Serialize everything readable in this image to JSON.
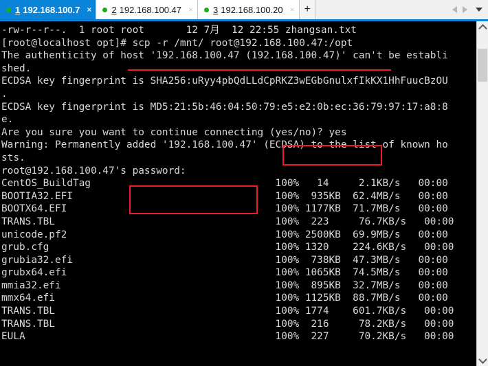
{
  "window": {
    "tab_nav": {
      "prev_icon": "chevron-left-icon",
      "next_icon": "chevron-right-icon",
      "menu_icon": "chevron-down-icon"
    },
    "new_tab_label": "+"
  },
  "tabs": [
    {
      "number": "1",
      "label": "192.168.100.7",
      "close_label": "×",
      "status": "connected",
      "active": true
    },
    {
      "number": "2",
      "label": "192.168.100.47",
      "close_label": "×",
      "status": "connected",
      "active": false
    },
    {
      "number": "3",
      "label": "192.168.100.20",
      "close_label": "×",
      "status": "connected",
      "active": false
    }
  ],
  "terminal": {
    "lines": [
      "-rw-r--r--.  1 root root       12 7月  12 22:55 zhangsan.txt",
      "[root@localhost opt]# scp -r /mnt/ root@192.168.100.47:/opt",
      "The authenticity of host '192.168.100.47 (192.168.100.47)' can't be establi",
      "shed.",
      "ECDSA key fingerprint is SHA256:uRyy4pbQdLLdCpRKZ3wEGbGnulxfIkKX1HhFuucBzOU",
      ".",
      "ECDSA key fingerprint is MD5:21:5b:46:04:50:79:e5:e2:0b:ec:36:79:97:17:a8:8",
      "e.",
      "Are you sure you want to continue connecting (yes/no)? yes",
      "Warning: Permanently added '192.168.100.47' (ECDSA) to the list of known ho",
      "sts.",
      "root@192.168.100.47's password:",
      "CentOS_BuildTag                               100%   14     2.1KB/s   00:00",
      "BOOTIA32.EFI                                  100%  935KB  62.4MB/s   00:00",
      "BOOTX64.EFI                                   100% 1177KB  71.7MB/s   00:00",
      "TRANS.TBL                                     100%  223     76.7KB/s   00:00",
      "unicode.pf2                                   100% 2500KB  69.9MB/s   00:00",
      "grub.cfg                                      100% 1320    224.6KB/s   00:00",
      "grubia32.efi                                  100%  738KB  47.3MB/s   00:00",
      "grubx64.efi                                   100% 1065KB  74.5MB/s   00:00",
      "mmia32.efi                                    100%  895KB  32.7MB/s   00:00",
      "mmx64.efi                                     100% 1125KB  88.7MB/s   00:00",
      "TRANS.TBL                                     100% 1774    601.7KB/s   00:00",
      "TRANS.TBL                                     100%  216     78.2KB/s   00:00",
      "EULA                                          100%  227     70.2KB/s   00:00"
    ],
    "command": "scp -r /mnt/ root@192.168.100.47:/opt",
    "prompt": "[root@localhost opt]#",
    "confirm_answer": "yes",
    "password_prompt": "password:",
    "transfers": [
      {
        "file": "CentOS_BuildTag",
        "percent": "100%",
        "size": "14",
        "speed": "2.1KB/s",
        "eta": "00:00"
      },
      {
        "file": "BOOTIA32.EFI",
        "percent": "100%",
        "size": "935KB",
        "speed": "62.4MB/s",
        "eta": "00:00"
      },
      {
        "file": "BOOTX64.EFI",
        "percent": "100%",
        "size": "1177KB",
        "speed": "71.7MB/s",
        "eta": "00:00"
      },
      {
        "file": "TRANS.TBL",
        "percent": "100%",
        "size": "223",
        "speed": "76.7KB/s",
        "eta": "00:00"
      },
      {
        "file": "unicode.pf2",
        "percent": "100%",
        "size": "2500KB",
        "speed": "69.9MB/s",
        "eta": "00:00"
      },
      {
        "file": "grub.cfg",
        "percent": "100%",
        "size": "1320",
        "speed": "224.6KB/s",
        "eta": "00:00"
      },
      {
        "file": "grubia32.efi",
        "percent": "100%",
        "size": "738KB",
        "speed": "47.3MB/s",
        "eta": "00:00"
      },
      {
        "file": "grubx64.efi",
        "percent": "100%",
        "size": "1065KB",
        "speed": "74.5MB/s",
        "eta": "00:00"
      },
      {
        "file": "mmia32.efi",
        "percent": "100%",
        "size": "895KB",
        "speed": "32.7MB/s",
        "eta": "00:00"
      },
      {
        "file": "mmx64.efi",
        "percent": "100%",
        "size": "1125KB",
        "speed": "88.7MB/s",
        "eta": "00:00"
      },
      {
        "file": "TRANS.TBL",
        "percent": "100%",
        "size": "1774",
        "speed": "601.7KB/s",
        "eta": "00:00"
      },
      {
        "file": "TRANS.TBL",
        "percent": "100%",
        "size": "216",
        "speed": "78.2KB/s",
        "eta": "00:00"
      },
      {
        "file": "EULA",
        "percent": "100%",
        "size": "227",
        "speed": "70.2KB/s",
        "eta": "00:00"
      }
    ]
  },
  "annotations": [
    {
      "kind": "underline",
      "target": "scp-command"
    },
    {
      "kind": "box",
      "target": "yes-no-confirm"
    },
    {
      "kind": "box",
      "target": "password-prompt"
    }
  ],
  "colors": {
    "accent": "#0a84d8",
    "annotation": "#ee1c24",
    "terminal_bg": "#000000",
    "terminal_fg": "#d8d8d8",
    "status_dot": "#1aae1a"
  }
}
